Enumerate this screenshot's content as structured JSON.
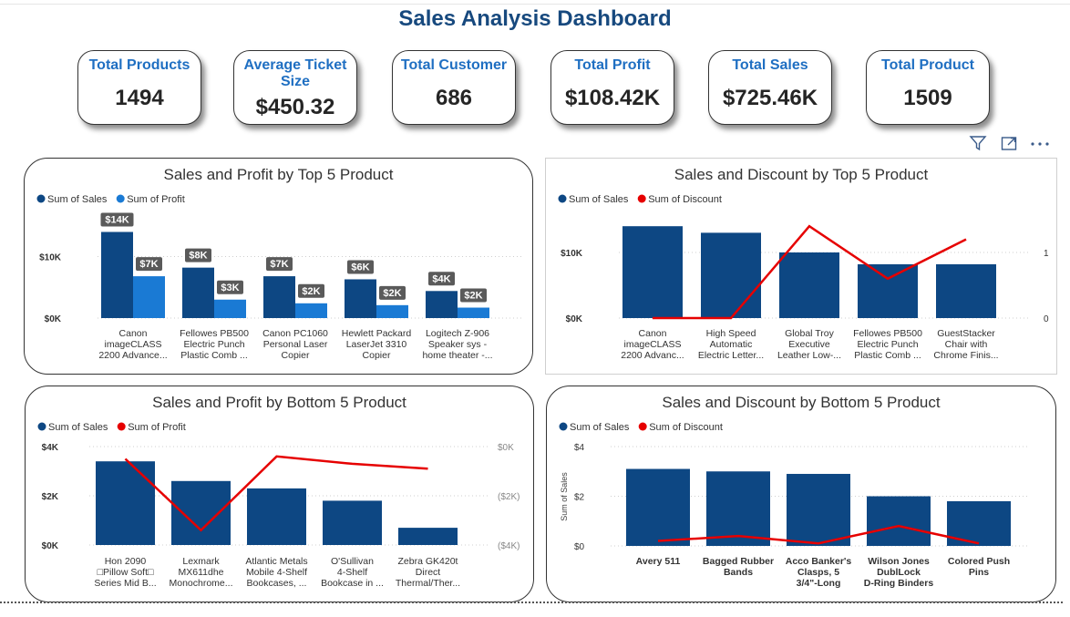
{
  "dashboard": {
    "title": "Sales Analysis Dashboard"
  },
  "kpis": [
    {
      "label": "Total Products",
      "value": "1494"
    },
    {
      "label": "Average Ticket Size",
      "value": "$450.32"
    },
    {
      "label": "Total Customer",
      "value": "686"
    },
    {
      "label": "Total Profit",
      "value": "$108.42K"
    },
    {
      "label": "Total Sales",
      "value": "$725.46K"
    },
    {
      "label": "Total Product",
      "value": "1509"
    }
  ],
  "toolbar": {
    "icons": [
      "filter-icon",
      "focus-mode-icon",
      "more-options-icon"
    ]
  },
  "colors": {
    "sales": "#0d4783",
    "profit_bar": "#1a7ad4",
    "red_line": "#e60000",
    "label_bg": "#5a5a5a"
  },
  "chart_data": [
    {
      "type": "bar",
      "title": "Sales and Profit by Top 5 Product",
      "categories": [
        [
          "Canon",
          "imageCLASS",
          "2200 Advance..."
        ],
        [
          "Fellowes PB500",
          "Electric Punch",
          "Plastic Comb ..."
        ],
        [
          "Canon PC1060",
          "Personal Laser",
          "Copier"
        ],
        [
          "Hewlett Packard",
          "LaserJet 3310",
          "Copier"
        ],
        [
          "Logitech Z-906",
          "Speaker sys -",
          "home theater -..."
        ]
      ],
      "series": [
        {
          "name": "Sum of Sales",
          "values": [
            14000,
            8200,
            6800,
            6300,
            4400
          ],
          "labels": [
            "$14K",
            "$8K",
            "$7K",
            "$6K",
            "$4K"
          ]
        },
        {
          "name": "Sum of Profit",
          "values": [
            6800,
            3000,
            2400,
            2100,
            1700
          ],
          "labels": [
            "$7K",
            "$3K",
            "$2K",
            "$2K",
            "$2K"
          ]
        }
      ],
      "yticks": [
        "$0K",
        "$10K"
      ],
      "ylim": [
        0,
        16000
      ],
      "legend": "top-left"
    },
    {
      "type": "bar",
      "title": "Sales and Discount by Top 5 Product",
      "categories": [
        [
          "Canon",
          "imageCLASS",
          "2200 Advanc..."
        ],
        [
          "High Speed",
          "Automatic",
          "Electric Letter..."
        ],
        [
          "Global Troy",
          "Executive",
          "Leather Low-..."
        ],
        [
          "Fellowes PB500",
          "Electric Punch",
          "Plastic Comb ..."
        ],
        [
          "GuestStacker",
          "Chair with",
          "Chrome Finis..."
        ]
      ],
      "series": [
        {
          "name": "Sum of Sales",
          "type": "bar",
          "values": [
            14000,
            13000,
            10000,
            8200,
            8200
          ]
        },
        {
          "name": "Sum of Discount",
          "type": "line",
          "values": [
            0,
            0,
            1.4,
            0.6,
            1.2
          ]
        }
      ],
      "yticks": [
        "$0K",
        "$10K"
      ],
      "ylim": [
        0,
        20000
      ],
      "y2ticks": [
        "0",
        "1"
      ],
      "y2lim": [
        0,
        1.4
      ],
      "legend": "top-left"
    },
    {
      "type": "bar",
      "title": "Sales and Profit by Bottom 5 Product",
      "categories": [
        [
          "Hon 2090",
          "□Pillow Soft□",
          "Series Mid B..."
        ],
        [
          "Lexmark",
          "MX611dhe",
          "Monochrome..."
        ],
        [
          "Atlantic Metals",
          "Mobile 4-Shelf",
          "Bookcases, ..."
        ],
        [
          "O'Sullivan",
          "4-Shelf",
          "Bookcase in ..."
        ],
        [
          "Zebra GK420t",
          "Direct",
          "Thermal/Ther..."
        ]
      ],
      "series": [
        {
          "name": "Sum of Sales",
          "type": "bar",
          "values": [
            3.4,
            2.6,
            2.3,
            1.8,
            0.7
          ]
        },
        {
          "name": "Sum of Profit",
          "type": "line",
          "values": [
            -500,
            -3400,
            -400,
            -700,
            -900
          ]
        }
      ],
      "yticks": [
        "$0K",
        "$2K",
        "$4K"
      ],
      "ylim": [
        0,
        4
      ],
      "y2ticks": [
        "($4K)",
        "($2K)",
        "$0K"
      ],
      "y2lim": [
        -4000,
        0
      ],
      "legend": "top-left"
    },
    {
      "type": "bar",
      "title": "Sales and Discount by Bottom 5 Product",
      "categories": [
        [
          "Avery 511"
        ],
        [
          "Bagged Rubber",
          "Bands"
        ],
        [
          "Acco Banker's",
          "Clasps, 5",
          "3/4\"-Long"
        ],
        [
          "Wilson Jones",
          "DublLock",
          "D-Ring Binders"
        ],
        [
          "Colored Push",
          "Pins"
        ]
      ],
      "series": [
        {
          "name": "Sum of Sales",
          "type": "bar",
          "values": [
            3.1,
            3.0,
            2.9,
            2.0,
            1.8
          ]
        },
        {
          "name": "Sum of Discount",
          "type": "line",
          "values": [
            0.2,
            0.4,
            0.1,
            0.8,
            0.1
          ]
        }
      ],
      "yticks": [
        "$0",
        "$2",
        "$4"
      ],
      "ylim": [
        0,
        4
      ],
      "y2lim": [
        0,
        4
      ],
      "ylabel": "Sum of Sales",
      "legend": "top-left"
    }
  ]
}
